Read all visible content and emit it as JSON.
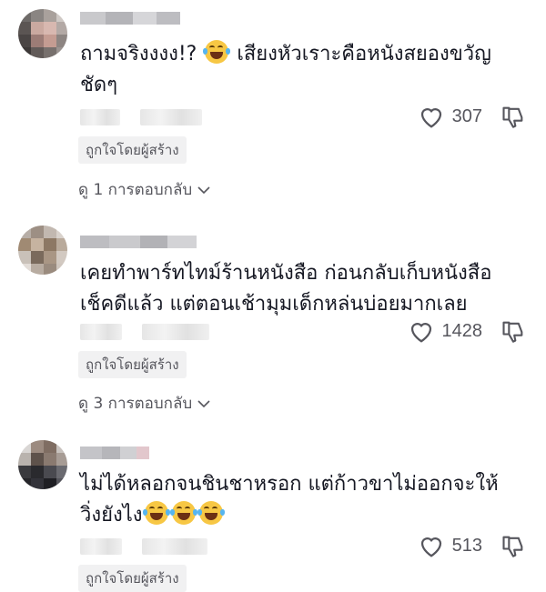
{
  "comments": [
    {
      "text": "ถามจริงงงง!? 😂 เสียงหัวเราะคือหนังสยองขวัญชัดๆ",
      "text_parts": [
        "ถามจริงงงง!? ",
        " เสียงหัวเราะคือหนังสยองขวัญชัดๆ"
      ],
      "likes": "307",
      "badge": "ถูกใจโดยผู้สร้าง",
      "replies": "ดู 1 การตอบกลับ"
    },
    {
      "text": "เคยทำพาร์ทไทม์ร้านหนังสือ ก่อนกลับเก็บหนังสือเช็คดีแล้ว แต่ตอนเช้ามุมเด็กหล่นบ่อยมากเลย",
      "likes": "1428",
      "badge": "ถูกใจโดยผู้สร้าง",
      "replies": "ดู 3 การตอบกลับ"
    },
    {
      "text": "ไม่ได้หลอกจนชินชาหรอก แต่ก้าวขาไม่ออกจะให้วิ่งยังไง😂😂😂",
      "text_parts": [
        "ไม่ได้หลอกจนชินชาหรอก แต่ก้าวขาไม่ออกจะให้วิ่งยังไง"
      ],
      "likes": "513",
      "badge": "ถูกใจโดยผู้สร้าง"
    }
  ],
  "icons": {
    "like": "heart-outline-icon",
    "dislike": "thumbs-down-icon",
    "expand": "chevron-down-icon",
    "emoji": "face-with-tears-of-joy-icon"
  },
  "colors": {
    "text": "#161823",
    "secondary": "#56565d",
    "badge_bg": "#f1f1f2",
    "emoji": "#f7c744"
  }
}
